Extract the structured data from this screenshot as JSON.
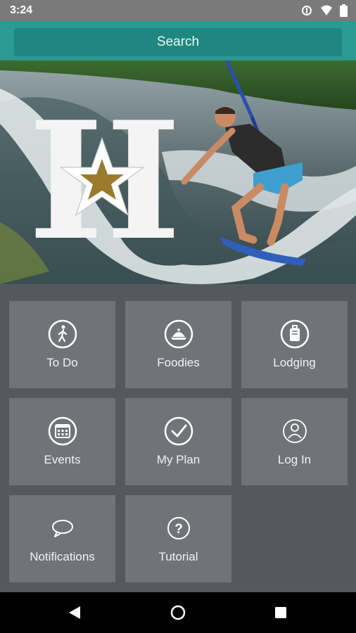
{
  "status": {
    "time": "3:24"
  },
  "search": {
    "label": "Search"
  },
  "hero": {
    "logo_letter": "H"
  },
  "tiles": [
    {
      "label": "To Do",
      "icon": "walking-person-icon"
    },
    {
      "label": "Foodies",
      "icon": "food-dish-icon"
    },
    {
      "label": "Lodging",
      "icon": "luggage-icon"
    },
    {
      "label": "Events",
      "icon": "calendar-icon"
    },
    {
      "label": "My Plan",
      "icon": "checkmark-icon"
    },
    {
      "label": "Log In",
      "icon": "user-icon"
    },
    {
      "label": "Notifications",
      "icon": "speech-bubble-icon"
    },
    {
      "label": "Tutorial",
      "icon": "question-icon"
    }
  ],
  "colors": {
    "accent": "#2a9a93",
    "tile": "#707478",
    "background": "#55595e",
    "gold": "#9a7b2c"
  }
}
